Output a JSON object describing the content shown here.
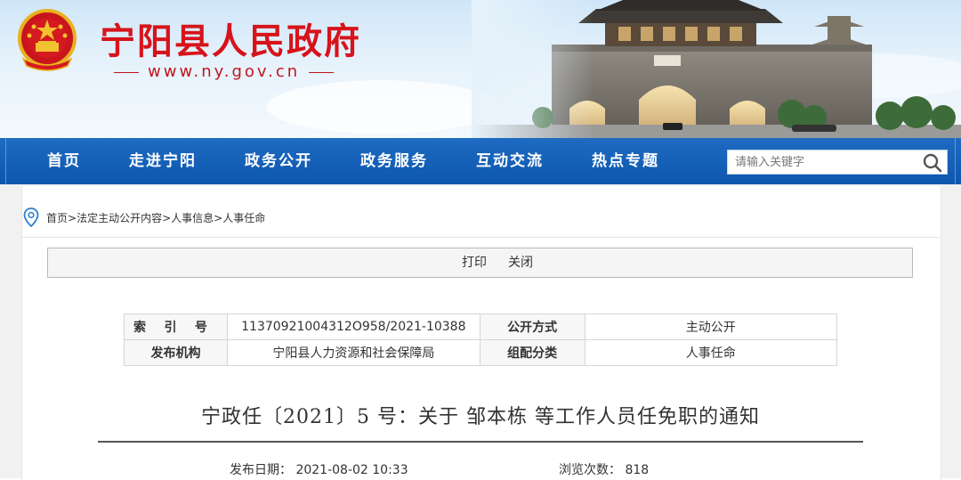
{
  "header": {
    "site_name": "宁阳县人民政府",
    "site_url": "www.ny.gov.cn",
    "emblem_icon": "national-emblem-icon",
    "brand_color": "#d7131b"
  },
  "nav": {
    "items": [
      {
        "label": "首页"
      },
      {
        "label": "走进宁阳"
      },
      {
        "label": "政务公开"
      },
      {
        "label": "政务服务"
      },
      {
        "label": "互动交流"
      },
      {
        "label": "热点专题"
      }
    ],
    "search_placeholder": "请输入关键字",
    "bar_color": "#0d57ae"
  },
  "breadcrumb": {
    "items": [
      "首页",
      "法定主动公开内容",
      "人事信息",
      "人事任命"
    ],
    "separator": ">"
  },
  "toolbar": {
    "print_label": "打印",
    "close_label": "关闭"
  },
  "meta": {
    "index_label": [
      "索",
      "引",
      "号"
    ],
    "index_value": "11370921004312O958/2021-10388",
    "open_mode_label": "公开方式",
    "open_mode_value": "主动公开",
    "publisher_label": "发布机构",
    "publisher_value": "宁阳县人力资源和社会保障局",
    "category_label": "组配分类",
    "category_value": "人事任命"
  },
  "article": {
    "title": "宁政任〔2021〕5 号：关于 邹本栋 等工作人员任免职的通知",
    "pubdate_label": "发布日期：",
    "pubdate_value": "2021-08-02 10:33",
    "views_label": "浏览次数：",
    "views_value": "818"
  }
}
